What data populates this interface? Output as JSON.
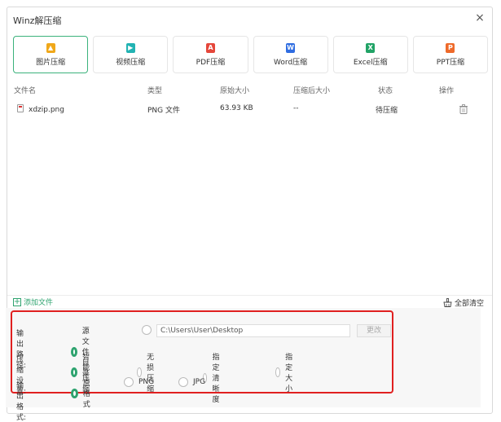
{
  "window": {
    "title": "Winz解压缩",
    "close_symbol": "×"
  },
  "tabs": [
    {
      "label": "图片压缩",
      "icon": "image-icon",
      "color": "#f0a81a",
      "glyph": "▲",
      "active": true
    },
    {
      "label": "视频压缩",
      "icon": "video-icon",
      "color": "#22b3b3",
      "glyph": "▶",
      "active": false
    },
    {
      "label": "PDF压缩",
      "icon": "pdf-icon",
      "color": "#e5473b",
      "glyph": "A",
      "active": false
    },
    {
      "label": "Word压缩",
      "icon": "word-icon",
      "color": "#2f6de1",
      "glyph": "W",
      "active": false
    },
    {
      "label": "Excel压缩",
      "icon": "excel-icon",
      "color": "#21a366",
      "glyph": "X",
      "active": false
    },
    {
      "label": "PPT压缩",
      "icon": "ppt-icon",
      "color": "#ee6a2a",
      "glyph": "P",
      "active": false
    }
  ],
  "table": {
    "headers": {
      "name": "文件名",
      "type": "类型",
      "orig_size": "原始大小",
      "new_size": "压缩后大小",
      "status": "状态",
      "action": "操作"
    },
    "rows": [
      {
        "name": "xdzip.png",
        "type": "PNG 文件",
        "orig_size": "63.93 KB",
        "new_size": "--",
        "status": "待压缩"
      }
    ]
  },
  "footer": {
    "add_file": "添加文件",
    "clear_all": "全部清空"
  },
  "settings": {
    "output_path": {
      "label": "输出路径:",
      "source_dir": "源文件目录",
      "custom_path": "C:\\Users\\User\\Desktop",
      "change": "更改"
    },
    "compression": {
      "label": "压缩设置:",
      "options": [
        "智能压缩",
        "无损压缩",
        "指定清晰度",
        "指定大小"
      ]
    },
    "format": {
      "label": "输出格式:",
      "options": [
        "原格式",
        "PNG",
        "JPG"
      ]
    }
  },
  "colors": {
    "accent": "#2ea36f",
    "highlight_border": "#e02020"
  }
}
